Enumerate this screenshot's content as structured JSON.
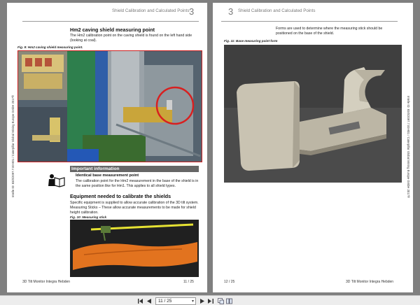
{
  "left_page": {
    "chapter_title": "Shield Calibration and Calculated Points",
    "chapter_number": "3",
    "side_text": "Intelle ID: 83/0/2097.7.00-801 / Caterpillar Global Mining Europe GmbH 2017®",
    "section_title": "Hm2 caving shield measuring point",
    "section_text": "The Hm2 calibration point on the caving shield is found on the left hand side (looking at coal).",
    "fig9_caption": "Fig. 9: Hm2 caving shield measuring point.",
    "info_heading": "Important information",
    "info_subheading": "Identical base measurement point",
    "info_text": "The calibration point for the Hm2 measurement in the base of the shield is in the same position like for Hm1. This applies to all shield types.",
    "equip_title": "Equipment needed to calibrate the shields",
    "equip_text": "Specific equipment is supplied to allow accurate calibration of the 3D tilt system. Measuring Sticks – These allow accurate measurements to be made for shield height calibration.",
    "fig10_caption": "Fig. 10: Measuring stick",
    "footer_left": "3D Tilt Monitor Integra Hebden",
    "footer_right": "11 / 25"
  },
  "right_page": {
    "chapter_number": "3",
    "chapter_title": "Shield Calibration and Calculated Points",
    "side_text": "Intelle ID: 83/0/2097.7.00-801 / Caterpillar Global Mining Europe GmbH 2017®",
    "intro_text": "Forms are used to determine where the measuring stick should be positioned on the base of the shield.",
    "fig11_caption": "Fig. 11: Base measuring point form",
    "footer_left": "12 / 25",
    "footer_right": "3D Tilt Monitor Integra Hebden"
  },
  "toolbar": {
    "page_value": "11 / 25",
    "icons": [
      "first-page-icon",
      "prev-page-icon",
      "next-page-icon",
      "last-page-icon",
      "single-page-view-icon",
      "two-page-view-icon"
    ]
  },
  "colors": {
    "viewer_bg": "#808080",
    "highlight_red": "#cc2020",
    "info_band": "#666666"
  }
}
